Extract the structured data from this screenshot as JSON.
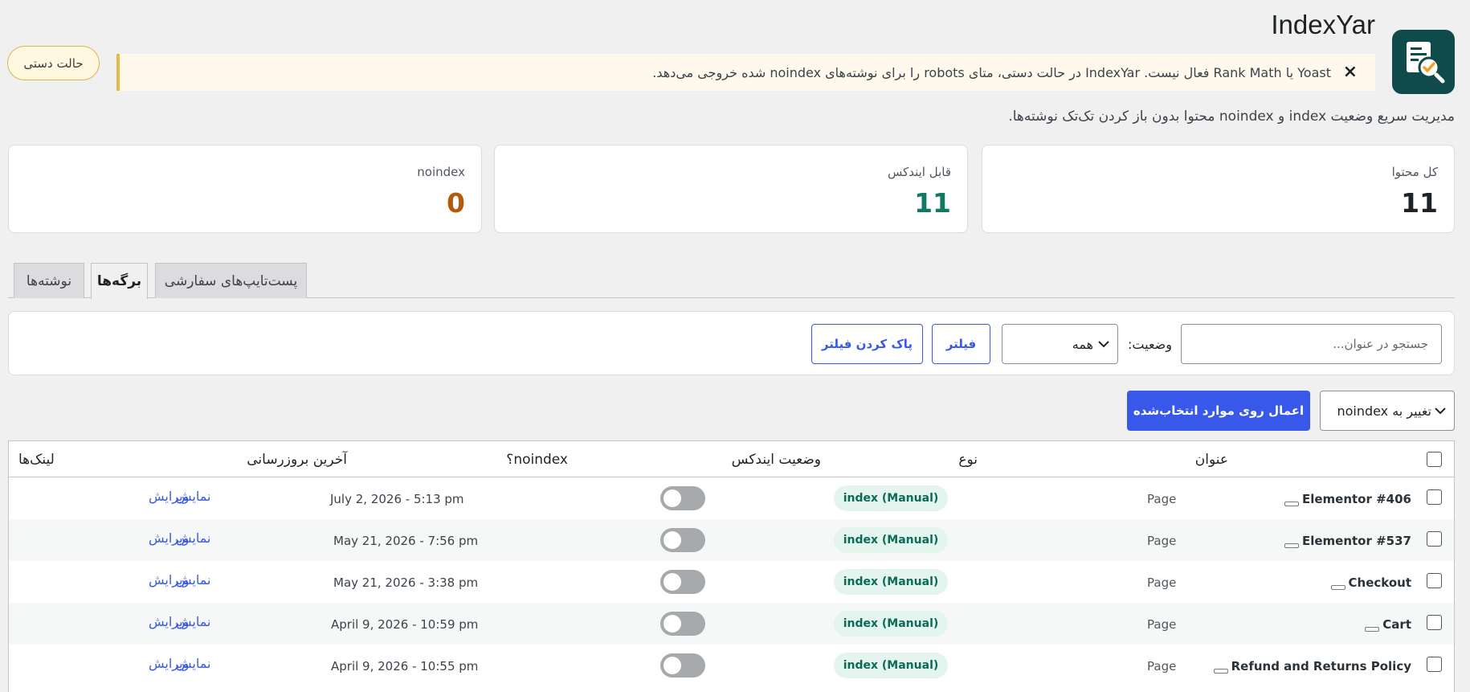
{
  "header": {
    "title": "IndexYar",
    "logo_icon": "document-search-check-icon",
    "mode_label": "حالت دستی"
  },
  "notice": {
    "text": "Yoast یا Rank Math فعال نیست. IndexYar در حالت دستی، متای robots را برای نوشته‌های noindex شده خروجی می‌دهد.",
    "close_label": "×"
  },
  "description": "مدیریت سریع وضعیت index و noindex محتوا بدون باز کردن تک‌تک نوشته‌ها.",
  "stats": [
    {
      "label": "کل محتوا",
      "value": "11",
      "color": "#1d2327"
    },
    {
      "label": "قابل ایندکس",
      "value": "11",
      "color": "#0f7a63"
    },
    {
      "label": "noindex",
      "value": "0",
      "color": "#b5590a"
    }
  ],
  "tabs": [
    {
      "label": "نوشته‌ها",
      "active": false
    },
    {
      "label": "برگه‌ها",
      "active": true
    },
    {
      "label": "پست‌تایپ‌های سفارشی",
      "active": false
    }
  ],
  "filters": {
    "search_placeholder": "جستجو در عنوان...",
    "status_label": "وضعیت:",
    "status_value": "همه",
    "filter_button": "فیلتر",
    "clear_button": "پاک کردن فیلتر"
  },
  "bulk": {
    "action_value": "تغییر به noindex",
    "apply_button": "اعمال روی موارد انتخاب‌شده"
  },
  "table": {
    "columns": {
      "title": "عنوان",
      "type": "نوع",
      "index_status": "وضعیت ایندکس",
      "noindex": "noindex؟",
      "updated": "آخرین بروزرسانی",
      "links": "لینک‌ها"
    },
    "rows": [
      {
        "title": "Elementor #406",
        "type": "Page",
        "status": "index (Manual)",
        "noindex": false,
        "updated": "July 2, 2026 - 5:13 pm",
        "view": "نمایش",
        "edit": "ویرایش"
      },
      {
        "title": "Elementor #537",
        "type": "Page",
        "status": "index (Manual)",
        "noindex": false,
        "updated": "May 21, 2026 - 7:56 pm",
        "view": "نمایش",
        "edit": "ویرایش"
      },
      {
        "title": "Checkout",
        "type": "Page",
        "status": "index (Manual)",
        "noindex": false,
        "updated": "May 21, 2026 - 3:38 pm",
        "view": "نمایش",
        "edit": "ویرایش"
      },
      {
        "title": "Cart",
        "type": "Page",
        "status": "index (Manual)",
        "noindex": false,
        "updated": "April 9, 2026 - 10:59 pm",
        "view": "نمایش",
        "edit": "ویرایش"
      },
      {
        "title": "Refund and Returns Policy",
        "type": "Page",
        "status": "index (Manual)",
        "noindex": false,
        "updated": "April 9, 2026 - 10:55 pm",
        "view": "نمایش",
        "edit": "ویرایش"
      }
    ]
  },
  "colors": {
    "primary": "#3858e9",
    "badge_bg": "#e4f4ef",
    "badge_text": "#0c6b57",
    "notice_border": "#e7b94a"
  }
}
